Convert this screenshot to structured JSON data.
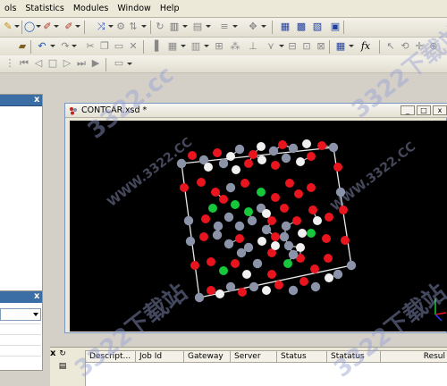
{
  "menu": {
    "items": [
      "ols",
      "Statistics",
      "Modules",
      "Window",
      "Help"
    ]
  },
  "document": {
    "title": "CONTCAR.xsd *",
    "minimize": "_",
    "maximize": "□",
    "close": "x"
  },
  "left_panel": {
    "close": "x"
  },
  "left_panel_2": {
    "close": "x"
  },
  "bottom_panel": {
    "close": "x",
    "columns": [
      "Descript...",
      "Job Id",
      "Gateway",
      "Server",
      "Status",
      "Statatus",
      "Resul"
    ]
  },
  "watermark": {
    "texts": [
      "3322.cc",
      "WWW.3322.CC",
      "3322下载站"
    ]
  },
  "colors": {
    "viewer_bg": "#000000",
    "atom_red": "#e8141e",
    "atom_white": "#f0f0f0",
    "atom_gray": "#8a93a8",
    "atom_green": "#16c83a",
    "bond": "#c8c8c8",
    "cell_edge": "#e8e8e8"
  }
}
